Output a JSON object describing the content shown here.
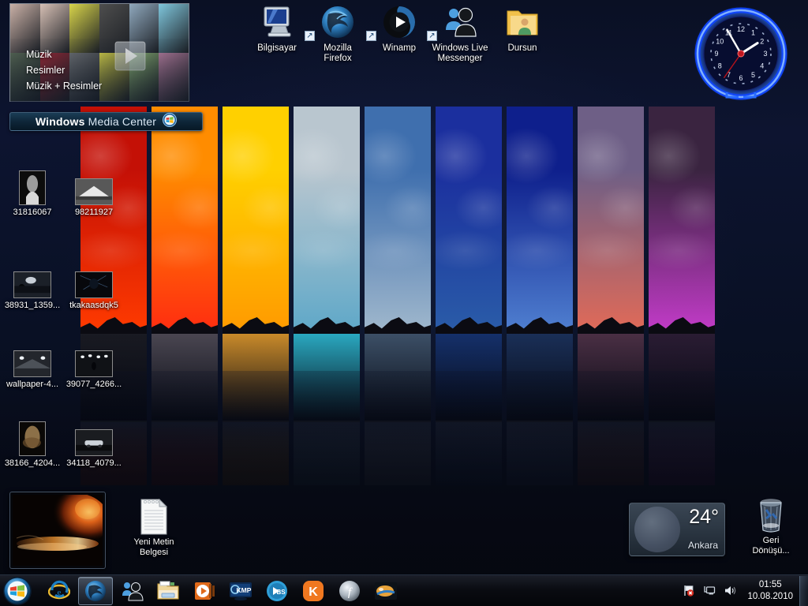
{
  "wallpaper": {
    "description": "Vertical photo strips of skies and seascapes with water reflection",
    "strips": [
      {
        "name": "red-sunset",
        "sky_top": "#c41006",
        "sky_bottom": "#ff3a00",
        "sea": "#191a22"
      },
      {
        "name": "orange-sunset",
        "sky_top": "#ff8c00",
        "sky_bottom": "#ff2d10",
        "sea": "#4a4651"
      },
      {
        "name": "golden-sun",
        "sky_top": "#ffd000",
        "sky_bottom": "#ff9a00",
        "sea": "#c98a2a"
      },
      {
        "name": "pale-clouds",
        "sky_top": "#b9c6cf",
        "sky_bottom": "#5fa8c8",
        "sea": "#2aa8c0"
      },
      {
        "name": "blue-clouds",
        "sky_top": "#3f6fae",
        "sky_bottom": "#9fb7cc",
        "sea": "#3c4f66"
      },
      {
        "name": "deep-blue-night",
        "sky_top": "#1b2f9e",
        "sky_bottom": "#2a5ca8",
        "sea": "#15306a"
      },
      {
        "name": "royal-blue",
        "sky_top": "#0e1f8c",
        "sky_bottom": "#4f7fd0",
        "sea": "#1a2f57"
      },
      {
        "name": "violet-dusk",
        "sky_top": "#6e5f86",
        "sky_bottom": "#e06a58",
        "sea": "#4a2f44"
      },
      {
        "name": "magenta-night",
        "sky_top": "#3a2440",
        "sky_bottom": "#c23bc8",
        "sea": "#2a1c33"
      }
    ]
  },
  "program_icons": [
    {
      "label": "Bilgisayar",
      "icon": "computer-icon",
      "shortcut": false
    },
    {
      "label": "Mozilla\nFirefox",
      "icon": "firefox-icon",
      "shortcut": true
    },
    {
      "label": "Winamp",
      "icon": "winamp-icon",
      "shortcut": true
    },
    {
      "label": "Windows Live\nMessenger",
      "icon": "messenger-icon",
      "shortcut": true
    },
    {
      "label": "Dursun",
      "icon": "user-folder-icon",
      "shortcut": false
    }
  ],
  "file_icons": [
    {
      "label": "31816067",
      "icon": "photo-thumbnail-icon"
    },
    {
      "label": "98211927",
      "icon": "photo-thumbnail-icon"
    },
    {
      "label": "38931_1359...",
      "icon": "photo-thumbnail-icon"
    },
    {
      "label": "tkakaasdqk5",
      "icon": "photo-thumbnail-icon"
    },
    {
      "label": "wallpaper-4...",
      "icon": "photo-thumbnail-icon"
    },
    {
      "label": "39077_4266...",
      "icon": "photo-thumbnail-icon"
    },
    {
      "label": "38166_4204...",
      "icon": "photo-thumbnail-icon"
    },
    {
      "label": "34118_4079...",
      "icon": "photo-thumbnail-icon"
    }
  ],
  "text_document": {
    "label": "Yeni Metin\nBelgesi",
    "icon": "text-file-icon"
  },
  "recycle_bin": {
    "label": "Geri\nDönüşü...",
    "icon": "recycle-bin-icon"
  },
  "media_center_gadget": {
    "menu_items": [
      "Müzik",
      "Resimler",
      "Müzik + Resimler"
    ],
    "banner_brand": "Windows",
    "banner_rest": " Media Center",
    "logo": "windows-flag-icon",
    "play_button": "play-icon",
    "tiles": [
      "#c9b0a6",
      "#d6bfb4",
      "#d8d44a",
      "#4e4e4e",
      "#8fa8bd",
      "#7fc6dc",
      "#5a6b57",
      "#a02a38",
      "#6f7276",
      "#d8d44a",
      "#8fb878",
      "#b87fa0"
    ]
  },
  "clock_gadget": {
    "name": "neon-analog-clock",
    "hour_numbers": [
      "12",
      "1",
      "2",
      "3",
      "4",
      "5",
      "6",
      "7",
      "8",
      "9",
      "10",
      "11"
    ],
    "time_shown": "01:55",
    "ring_color": "#1b5cff",
    "face_color": "#0a1038"
  },
  "weather_gadget": {
    "temperature": "24°",
    "city": "Ankara",
    "icon": "moon-icon"
  },
  "slideshow_gadget": {
    "name": "picture-slideshow",
    "image_description": "fiery nebula landscape"
  },
  "taskbar": {
    "start_button": {
      "label": "Start",
      "icon": "windows-start-orb-icon"
    },
    "buttons": [
      {
        "name": "internet-explorer",
        "icon": "ie-icon",
        "active": false
      },
      {
        "name": "mozilla-firefox",
        "icon": "firefox-icon",
        "active": true
      },
      {
        "name": "live-messenger",
        "icon": "messenger-icon",
        "active": false
      },
      {
        "name": "windows-explorer",
        "icon": "folder-icon",
        "active": false
      },
      {
        "name": "media-player",
        "icon": "media-player-icon",
        "active": false
      },
      {
        "name": "kmplayer",
        "icon": "kmplayer-icon",
        "active": false
      },
      {
        "name": "bs-player",
        "icon": "bsplayer-icon",
        "active": false
      },
      {
        "name": "kaspersky",
        "icon": "kaspersky-icon",
        "active": false
      },
      {
        "name": "flash-player",
        "icon": "flash-icon",
        "active": false
      },
      {
        "name": "paint-app",
        "icon": "paint-icon",
        "active": false
      }
    ],
    "tray": [
      {
        "name": "action-center",
        "icon": "flag-warning-icon"
      },
      {
        "name": "network",
        "icon": "network-monitor-icon"
      },
      {
        "name": "volume",
        "icon": "speaker-icon"
      }
    ],
    "clock": {
      "time": "01:55",
      "date": "10.08.2010"
    },
    "show_desktop": {
      "label": "Show desktop"
    }
  }
}
